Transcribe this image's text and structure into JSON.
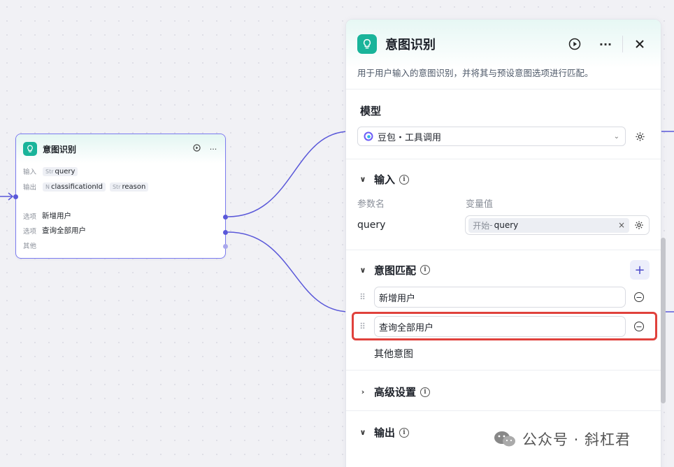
{
  "node": {
    "title": "意图识别",
    "input_label": "输入",
    "input_type": "Str",
    "input_name": "query",
    "output_label": "输出",
    "outputs": [
      {
        "type": "N",
        "name": "classificationId"
      },
      {
        "type": "Str",
        "name": "reason"
      }
    ],
    "options": [
      {
        "label": "选项",
        "value": "新增用户"
      },
      {
        "label": "选项",
        "value": "查询全部用户"
      },
      {
        "label": "其他",
        "value": ""
      }
    ]
  },
  "panel": {
    "title": "意图识别",
    "description": "用于用户输入的意图识别，并将其与预设意图选项进行匹配。",
    "model_section": "模型",
    "model_value": "豆包・工具调用",
    "input_section": "输入",
    "col_param": "参数名",
    "col_value": "变量值",
    "param_name": "query",
    "var_source": "开始",
    "var_sep": " - ",
    "var_name": "query",
    "intent_section": "意图匹配",
    "intents": [
      "新增用户",
      "查询全部用户"
    ],
    "other_intent": "其他意图",
    "advanced_section": "高级设置",
    "output_section": "输出"
  },
  "watermark": "公众号 · 斜杠君",
  "colors": {
    "accent": "#5a58d9",
    "brand": "#19b49a",
    "highlight": "#e0413c"
  }
}
